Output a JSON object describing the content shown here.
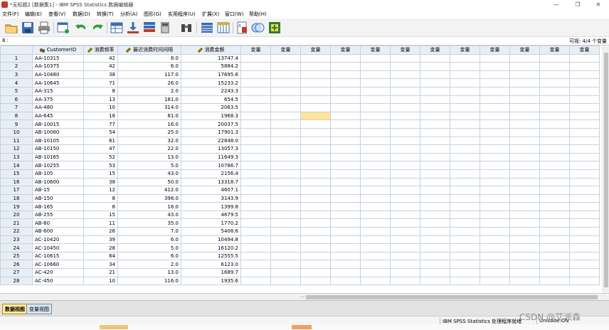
{
  "window": {
    "title": "*无标题2 [数据集1] - IBM SPSS Statistics 数据编辑器",
    "minimize": "—",
    "restore": "❐",
    "close": "✕"
  },
  "menu": [
    "文件(F)",
    "编辑(E)",
    "查看(V)",
    "数据(D)",
    "转换(T)",
    "分析(A)",
    "图形(G)",
    "实用程序(U)",
    "扩展(X)",
    "窗口(W)",
    "帮助(H)"
  ],
  "toolbar_icons": [
    "open-icon",
    "save-icon",
    "print-icon",
    "recall-dialog-icon",
    "undo-icon",
    "redo-icon",
    "goto-case-icon",
    "goto-variable-icon",
    "variables-icon",
    "run-descriptives-icon",
    "find-icon",
    "insert-cases-icon",
    "insert-variable-icon",
    "split-file-icon",
    "weight-cases-icon",
    "select-cases-icon",
    "value-labels-icon",
    "use-variable-sets-icon",
    "show-all-variables-icon",
    "spell-check-icon"
  ],
  "cellbar": {
    "ref": "8 :",
    "visible": "可视: 4/4 个变量"
  },
  "grid": {
    "headers": [
      "CustomerID",
      "消费频率",
      "最近消费时间间隔",
      "消费金额"
    ],
    "empty_header": "变量",
    "empty_column_count": 12,
    "selected_row": 8,
    "selected_col": 6,
    "rows": [
      [
        "1",
        "AA-10315",
        "42",
        "8.0",
        "13747.4"
      ],
      [
        "2",
        "AA-10375",
        "42",
        "6.0",
        "5884.2"
      ],
      [
        "3",
        "AA-10480",
        "38",
        "117.0",
        "17695.6"
      ],
      [
        "4",
        "AA-10645",
        "71",
        "26.0",
        "15233.2"
      ],
      [
        "5",
        "AA-315",
        "8",
        "2.0",
        "2243.3"
      ],
      [
        "6",
        "AA-375",
        "13",
        "181.0",
        "654.5"
      ],
      [
        "7",
        "AA-480",
        "10",
        "314.0",
        "2063.5"
      ],
      [
        "8",
        "AA-645",
        "18",
        "81.0",
        "1968.3"
      ],
      [
        "9",
        "AB-10015",
        "77",
        "16.0",
        "20037.5"
      ],
      [
        "10",
        "AB-10060",
        "54",
        "25.0",
        "17901.3"
      ],
      [
        "11",
        "AB-10105",
        "61",
        "32.0",
        "22848.0"
      ],
      [
        "12",
        "AB-10150",
        "47",
        "22.0",
        "13057.3"
      ],
      [
        "13",
        "AB-10165",
        "52",
        "13.0",
        "11649.3"
      ],
      [
        "14",
        "AB-10255",
        "53",
        "5.0",
        "10786.7"
      ],
      [
        "15",
        "AB-105",
        "15",
        "43.0",
        "2156.4"
      ],
      [
        "16",
        "AB-10600",
        "38",
        "50.0",
        "13318.7"
      ],
      [
        "17",
        "AB-15",
        "12",
        "412.0",
        "4607.1"
      ],
      [
        "18",
        "AB-150",
        "8",
        "398.0",
        "3143.9"
      ],
      [
        "19",
        "AB-165",
        "8",
        "16.0",
        "1399.8"
      ],
      [
        "20",
        "AB-255",
        "15",
        "43.0",
        "4679.5"
      ],
      [
        "21",
        "AB-60",
        "11",
        "35.0",
        "1770.2"
      ],
      [
        "22",
        "AB-600",
        "26",
        "7.0",
        "5408.6"
      ],
      [
        "23",
        "AC-10420",
        "39",
        "6.0",
        "10494.8"
      ],
      [
        "24",
        "AC-10450",
        "28",
        "5.0",
        "16120.2"
      ],
      [
        "25",
        "AC-10615",
        "64",
        "6.0",
        "12555.5"
      ],
      [
        "26",
        "AC-10660",
        "34",
        "2.0",
        "6123.0"
      ],
      [
        "27",
        "AC-420",
        "21",
        "13.0",
        "1689.7"
      ],
      [
        "28",
        "AC-450",
        "10",
        "116.0",
        "1935.6"
      ]
    ]
  },
  "tabs": [
    "数据视图",
    "变量视图"
  ],
  "status": {
    "processor": "IBM SPSS Statistics 处理程序就绪",
    "unicode": "Unicode:ON"
  },
  "watermark": "CSDN @艾派森",
  "colors": {
    "header_bg": "#e8eef6",
    "selected_cell": "#fde59a",
    "active_tab": "#ffe7a3"
  }
}
